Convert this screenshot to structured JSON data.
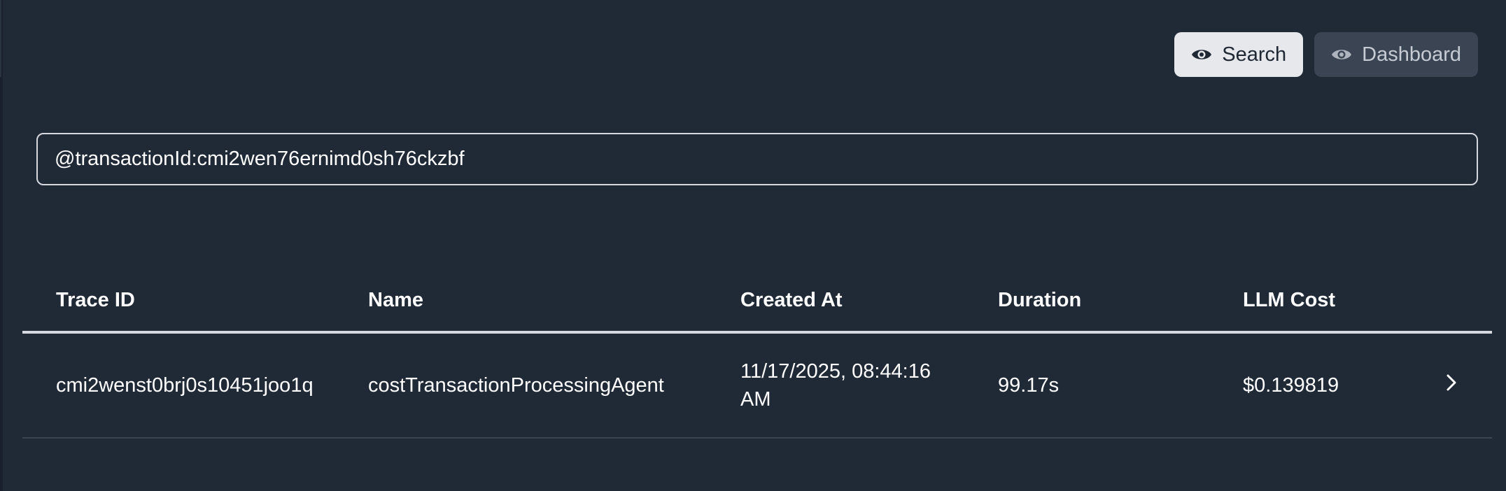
{
  "view_toggle": {
    "search_label": "Search",
    "dashboard_label": "Dashboard"
  },
  "search": {
    "value": "@transactionId:cmi2wen76ernimd0sh76ckzbf"
  },
  "table": {
    "headers": {
      "trace_id": "Trace ID",
      "name": "Name",
      "created_at": "Created At",
      "duration": "Duration",
      "llm_cost": "LLM Cost"
    },
    "rows": [
      {
        "trace_id": "cmi2wenst0brj0s10451joo1q",
        "name": "costTransactionProcessingAgent",
        "created_at": "11/17/2025, 08:44:16 AM",
        "duration": "99.17s",
        "llm_cost": "$0.139819"
      }
    ]
  },
  "colors": {
    "background": "#202936",
    "active_button_bg": "#e6e8ec",
    "inactive_button_bg": "#3a4453",
    "border": "#d5d9df"
  }
}
